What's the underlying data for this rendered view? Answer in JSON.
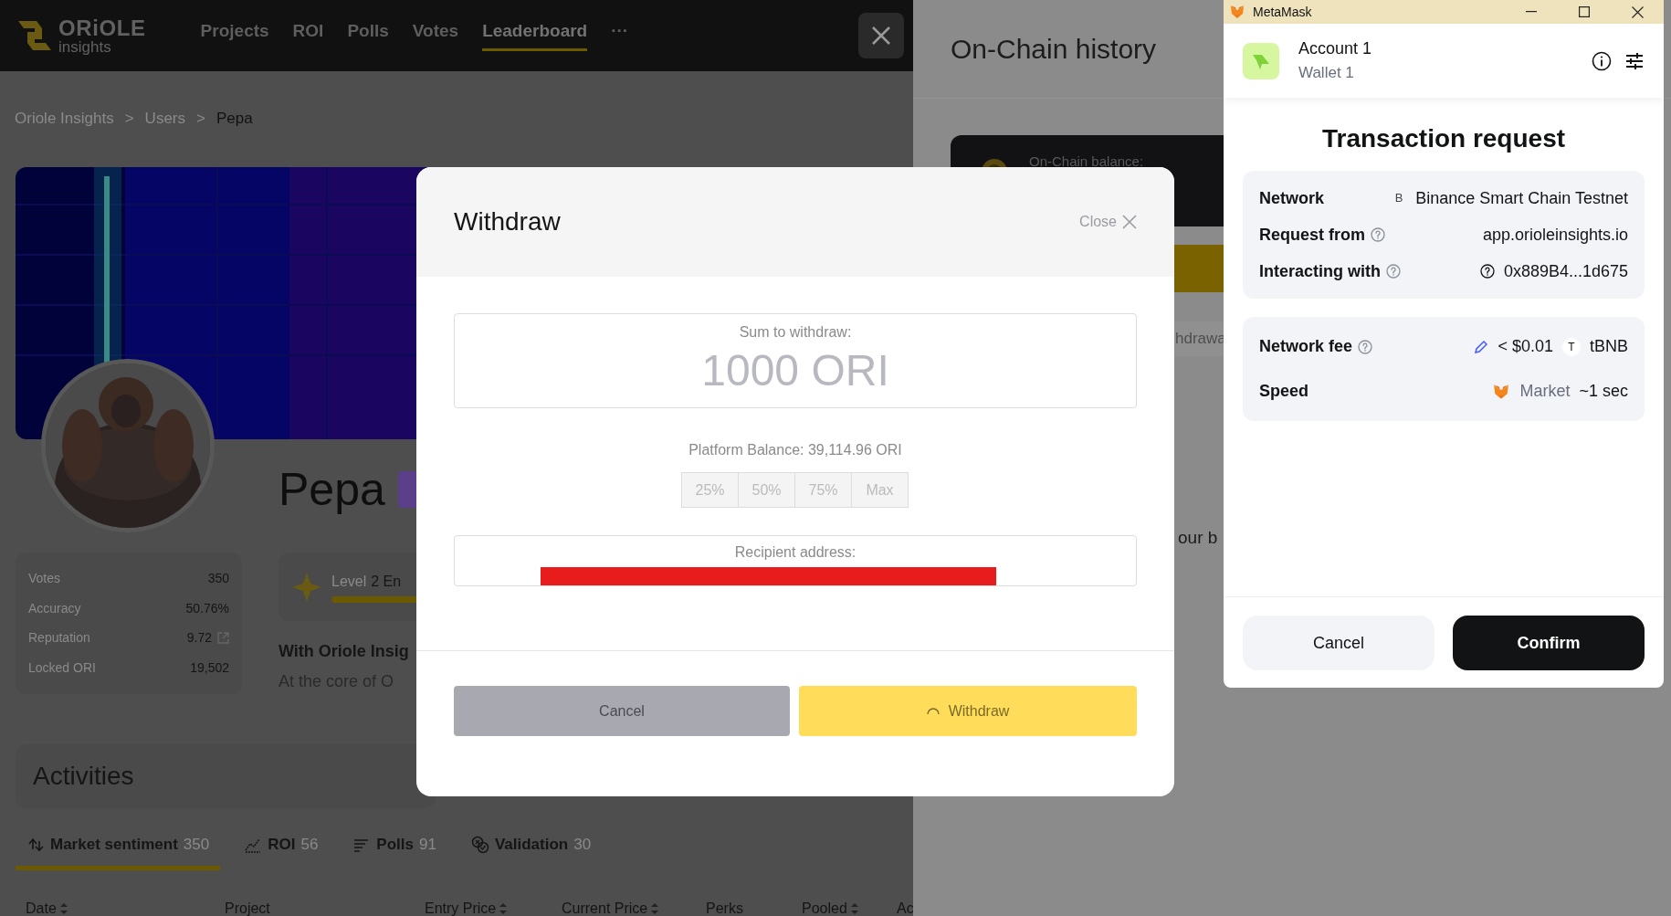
{
  "header": {
    "logo": {
      "word": "ORiOLE",
      "tagline": "insights"
    },
    "nav": [
      {
        "label": "Projects",
        "selected": false
      },
      {
        "label": "ROI",
        "selected": false
      },
      {
        "label": "Polls",
        "selected": false
      },
      {
        "label": "Votes",
        "selected": false
      },
      {
        "label": "Leaderboard",
        "selected": true
      },
      {
        "label": "···",
        "selected": false
      }
    ]
  },
  "breadcrumb": {
    "separator": ">",
    "items": [
      "Oriole Insights",
      "Users",
      "Pepa"
    ]
  },
  "profile": {
    "name": "Pepa",
    "stats": [
      {
        "label": "Votes",
        "value": "350",
        "link": false
      },
      {
        "label": "Accuracy",
        "value": "50.76%",
        "link": false
      },
      {
        "label": "Reputation",
        "value": "9.72",
        "link": true
      },
      {
        "label": "Locked ORI",
        "value": "19,502",
        "link": false
      }
    ],
    "level": {
      "label": "Level",
      "value": "2 En"
    },
    "about": {
      "title": "With Oriole Insig",
      "text": "At the core of O"
    }
  },
  "activities": {
    "title": "Activities",
    "tabs": [
      {
        "label": "Market sentiment",
        "count": "350",
        "selected": true
      },
      {
        "label": "ROI",
        "count": "56",
        "selected": false
      },
      {
        "label": "Polls",
        "count": "91",
        "selected": false
      },
      {
        "label": "Validation",
        "count": "30",
        "selected": false
      }
    ],
    "columns": [
      {
        "label": "Date",
        "sortable": true
      },
      {
        "label": "Project",
        "sortable": false
      },
      {
        "label": "Entry Price",
        "sortable": true
      },
      {
        "label": "Current Price",
        "sortable": true
      },
      {
        "label": "Perks",
        "sortable": false
      },
      {
        "label": "Pooled",
        "sortable": true
      },
      {
        "label": "Ac"
      }
    ]
  },
  "drawer": {
    "title": "On-Chain history",
    "balance_label": "On-Chain balance:",
    "tab_fragment": "hdrawa",
    "text_fragment": "our b"
  },
  "withdraw_modal": {
    "title": "Withdraw",
    "close": "Close",
    "sum_label": "Sum to withdraw:",
    "amount": "1000 ORI",
    "balance": "Platform Balance: 39,114.96 ORI",
    "presets": [
      "25%",
      "50%",
      "75%",
      "Max"
    ],
    "recipient_label": "Recipient address:",
    "cancel": "Cancel",
    "submit": "Withdraw",
    "loading": true
  },
  "metamask": {
    "window_title": "MetaMask",
    "account": "Account 1",
    "wallet": "Wallet 1",
    "heading": "Transaction request",
    "details": [
      {
        "kind": "network",
        "label": "Network",
        "help": false,
        "badge": "B",
        "value": "Binance Smart Chain Testnet"
      },
      {
        "kind": "origin",
        "label": "Request from",
        "help": true,
        "value": "app.orioleinsights.io"
      },
      {
        "kind": "contract",
        "label": "Interacting with",
        "help": true,
        "value": "0x889B4...1d675"
      }
    ],
    "fees": [
      {
        "kind": "fee",
        "label": "Network fee",
        "help": true,
        "value": "< $0.01",
        "badge": "T",
        "token": "tBNB"
      },
      {
        "kind": "speed",
        "label": "Speed",
        "help": false,
        "value": "Market",
        "eta": "~1 sec"
      }
    ],
    "cancel": "Cancel",
    "confirm": "Confirm"
  }
}
